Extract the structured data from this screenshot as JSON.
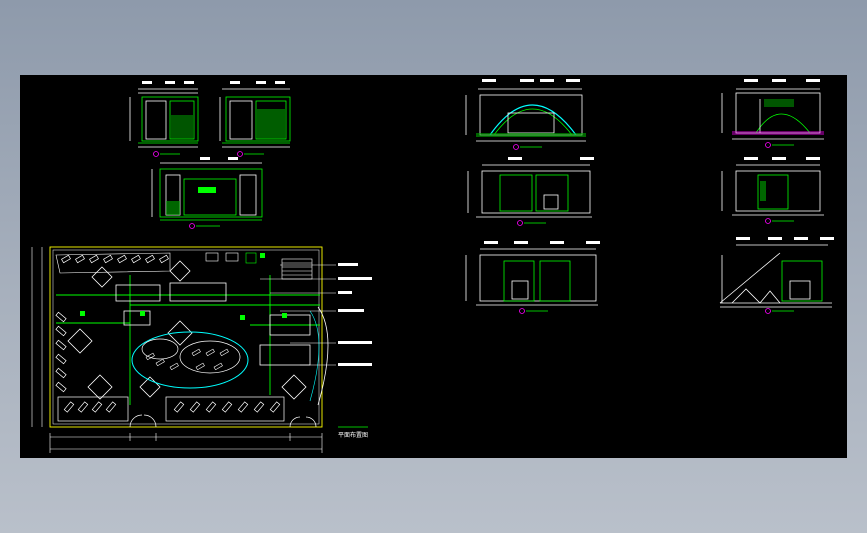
{
  "drawing": {
    "background": "#000000",
    "line_colors": {
      "primary": "#00ff00",
      "dimension": "#ffffff",
      "accent": "#00ffff",
      "highlight": "#ffff00"
    },
    "plan_title": "平面布置图"
  }
}
